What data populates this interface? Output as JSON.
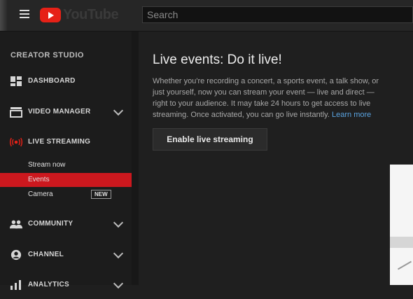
{
  "topbar": {
    "menu_icon": "hamburger-icon",
    "logo_text": "YouTube",
    "search_placeholder": "Search"
  },
  "sidebar": {
    "title": "CREATOR STUDIO",
    "items": [
      {
        "label": "DASHBOARD",
        "icon": "dashboard-icon",
        "chevron": false
      },
      {
        "label": "VIDEO MANAGER",
        "icon": "video-manager-icon",
        "chevron": true
      },
      {
        "label": "LIVE STREAMING",
        "icon": "live-icon",
        "chevron": false
      },
      {
        "label": "COMMUNITY",
        "icon": "community-icon",
        "chevron": true
      },
      {
        "label": "CHANNEL",
        "icon": "channel-icon",
        "chevron": true
      },
      {
        "label": "ANALYTICS",
        "icon": "analytics-icon",
        "chevron": true
      }
    ],
    "live_sub_items": [
      {
        "label": "Stream now"
      },
      {
        "label": "Events",
        "active": true
      },
      {
        "label": "Camera",
        "badge": "NEW"
      }
    ]
  },
  "main": {
    "title": "Live events: Do it live!",
    "description": "Whether you're recording a concert, a sports event, a talk show, or just yourself, now you can stream your event — live and direct — right to your audience. It may take 24 hours to get access to live streaming. Once activated, you can go live instantly.",
    "learn_more": "Learn more",
    "enable_button": "Enable live streaming"
  },
  "colors": {
    "accent": "#cc181e",
    "link": "#5aa3e0",
    "live_icon": "#e62117"
  }
}
